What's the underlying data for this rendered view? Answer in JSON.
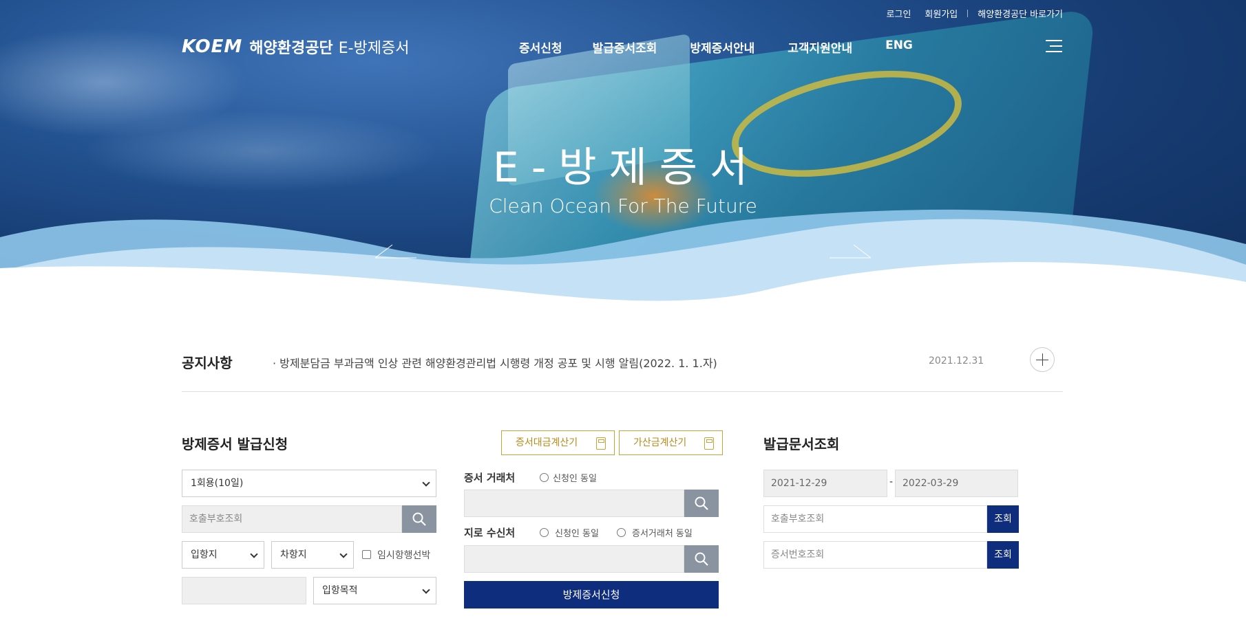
{
  "top_menu": {
    "login": "로그인",
    "signup": "회원가입",
    "shortcut": "해양환경공단 바로가기"
  },
  "logo": {
    "brand": "KOEM",
    "org": "해양환경공단",
    "service": "E-방제증서"
  },
  "gnb": [
    "증서신청",
    "발급증서조회",
    "방제증서안내",
    "고객지원안내",
    "ENG"
  ],
  "hero": {
    "title": "E-방제증서",
    "subtitle": "Clean Ocean For The Future"
  },
  "notice": {
    "label": "공지사항",
    "text": "· 방제분담금 부과금액 인상 관련 해양환경관리법 시행령 개정 공포 및 시행 알림(2022. 1. 1.자)",
    "date": "2021.12.31"
  },
  "apply": {
    "title": "방제증서 발급신청",
    "calc_cert": "증서대금계산기",
    "calc_add": "가산금계산기",
    "usage_select": "1회용(10일)",
    "callsign_placeholder": "호출부호조회",
    "port_in": "입항지",
    "port_next": "차항지",
    "temp_ship": "임시항행선박",
    "purpose": "입항목적",
    "cert_partner": "증서 거래처",
    "same_applicant": "신청인 동일",
    "giro_receiver": "지로 수신처",
    "same_applicant2": "신청인 동일",
    "same_partner": "증서거래처 동일",
    "submit": "방제증서신청"
  },
  "inquiry": {
    "title": "발급문서조회",
    "date_from": "2021-12-29",
    "dash": "-",
    "date_to": "2022-03-29",
    "callsign_placeholder": "호출부호조회",
    "certno_placeholder": "증서번호조회",
    "search": "조회",
    "search2": "조회"
  }
}
